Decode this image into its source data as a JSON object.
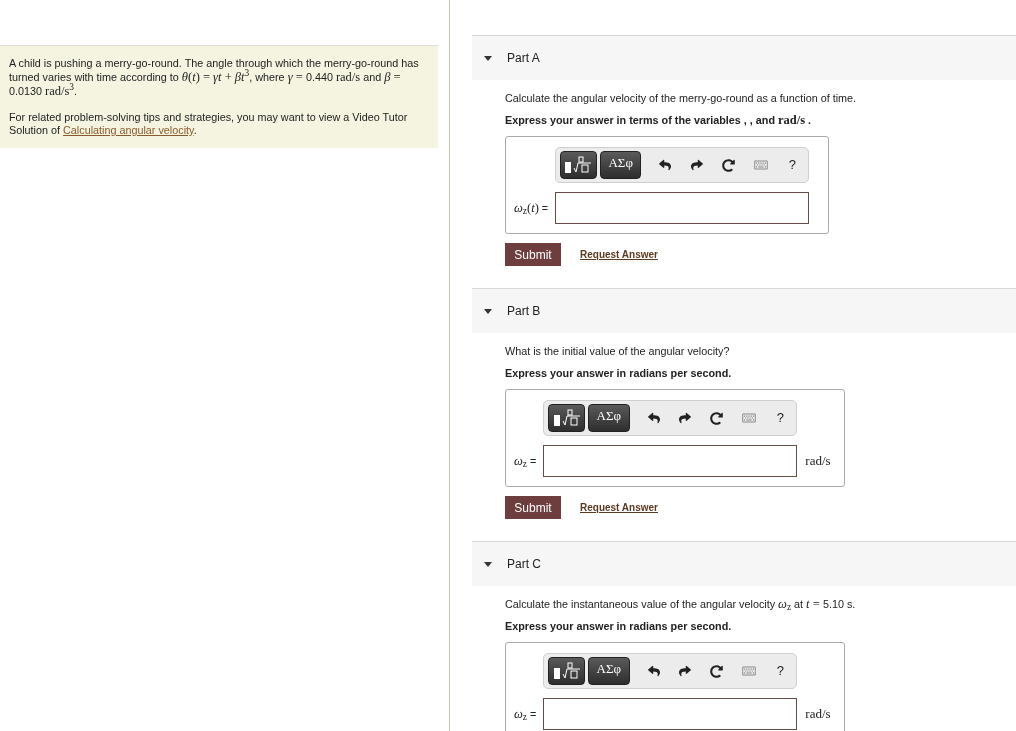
{
  "problem": {
    "statement": [
      {
        "text": "A child is pushing a merry-go-round. The angle through which the merry-go-round has turned varies with time according to "
      },
      {
        "kind": "math",
        "text": "*θ*(*t*) = *γt* + *βt*$^{3}$"
      },
      {
        "text": ", where "
      },
      {
        "kind": "math",
        "text": "*γ* = "
      },
      {
        "text": "0.440 "
      },
      {
        "kind": "math",
        "text": "rad/s"
      },
      {
        "text": " and "
      },
      {
        "kind": "math",
        "text": "*β* = "
      },
      {
        "text": "0.0130 "
      },
      {
        "kind": "math",
        "text": "rad/s$^{3}$"
      },
      {
        "text": "."
      }
    ],
    "tip": {
      "text": "For related problem-solving tips and strategies, you may want to view a Video Tutor Solution of ",
      "link": "Calculating angular velocity",
      "after": "."
    }
  },
  "parts": [
    {
      "title": "Part A",
      "expanded": true,
      "question": [
        {
          "text": "Calculate the angular velocity of the merry-go-round as a function of time."
        }
      ],
      "instruction": [
        {
          "text": "Express your answer in terms of the variables , , and "
        },
        {
          "kind": "math",
          "text": "rad/s"
        },
        {
          "text": " ."
        }
      ],
      "toolbar": {
        "symbols": "ΑΣφ",
        "help": "?"
      },
      "answer": {
        "label": [
          {
            "kind": "math",
            "text": "*ω*$_{z}$(*t*)"
          },
          {
            "text": " ="
          }
        ]
      },
      "submit": "Submit",
      "request": "Request Answer"
    },
    {
      "title": "Part B",
      "expanded": true,
      "question": [
        {
          "text": "What is the initial value of the angular velocity?"
        }
      ],
      "instruction": [
        {
          "text": "Express your answer in radians per second."
        }
      ],
      "toolbar": {
        "symbols": "ΑΣφ",
        "help": "?"
      },
      "answer": {
        "label": [
          {
            "kind": "math",
            "text": "*ω*$_{z}$"
          },
          {
            "text": " ="
          }
        ],
        "unit": "rad/s"
      },
      "submit": "Submit",
      "request": "Request Answer"
    },
    {
      "title": "Part C",
      "expanded": true,
      "question": [
        {
          "text": "Calculate the instantaneous value of the angular velocity "
        },
        {
          "kind": "math",
          "text": "*ω*$_{z}$"
        },
        {
          "text": " at "
        },
        {
          "kind": "math",
          "text": "*t* = "
        },
        {
          "text": "5.10 s."
        }
      ],
      "instruction": [
        {
          "text": "Express your answer in radians per second."
        }
      ],
      "toolbar": {
        "symbols": "ΑΣφ",
        "help": "?"
      },
      "answer": {
        "label": [
          {
            "kind": "math",
            "text": "*ω*$_{z}$"
          },
          {
            "text": " ="
          }
        ],
        "unit": "rad/s"
      }
    }
  ]
}
